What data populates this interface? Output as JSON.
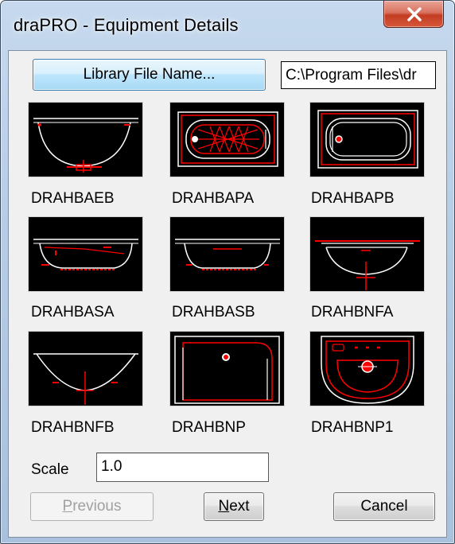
{
  "window": {
    "title": "draPRO - Equipment Details"
  },
  "library": {
    "button_label": "Library File Name...",
    "path_value": "C:\\Program Files\\dr"
  },
  "thumbnails": [
    {
      "label": "DRAHBAEB",
      "icon": "bathtub-elevation-icon"
    },
    {
      "label": "DRAHBAPA",
      "icon": "bathtub-plan-whirlpool-icon"
    },
    {
      "label": "DRAHBAPB",
      "icon": "bathtub-plan-icon"
    },
    {
      "label": "DRAHBASA",
      "icon": "bathtub-side-elevation-icon"
    },
    {
      "label": "DRAHBASB",
      "icon": "bathtub-side-elevation-b-icon"
    },
    {
      "label": "DRAHBNFA",
      "icon": "basin-front-elevation-icon"
    },
    {
      "label": "DRAHBNFB",
      "icon": "bowl-elevation-icon"
    },
    {
      "label": "DRAHBNP",
      "icon": "basin-plan-icon"
    },
    {
      "label": "DRAHBNP1",
      "icon": "basin-plan-faucet-icon"
    }
  ],
  "scale": {
    "label": "Scale",
    "value": "1.0"
  },
  "buttons": {
    "previous": {
      "pre": "",
      "mnemonic": "P",
      "post": "revious",
      "enabled": false
    },
    "next": {
      "pre": "",
      "mnemonic": "N",
      "post": "ext",
      "enabled": true
    },
    "cancel": {
      "label": "Cancel",
      "enabled": true
    }
  },
  "colors": {
    "cad_red": "#ff0000",
    "cad_white": "#ffffff",
    "close_button": "#c23d22",
    "lib_button": "#bee6fd"
  }
}
